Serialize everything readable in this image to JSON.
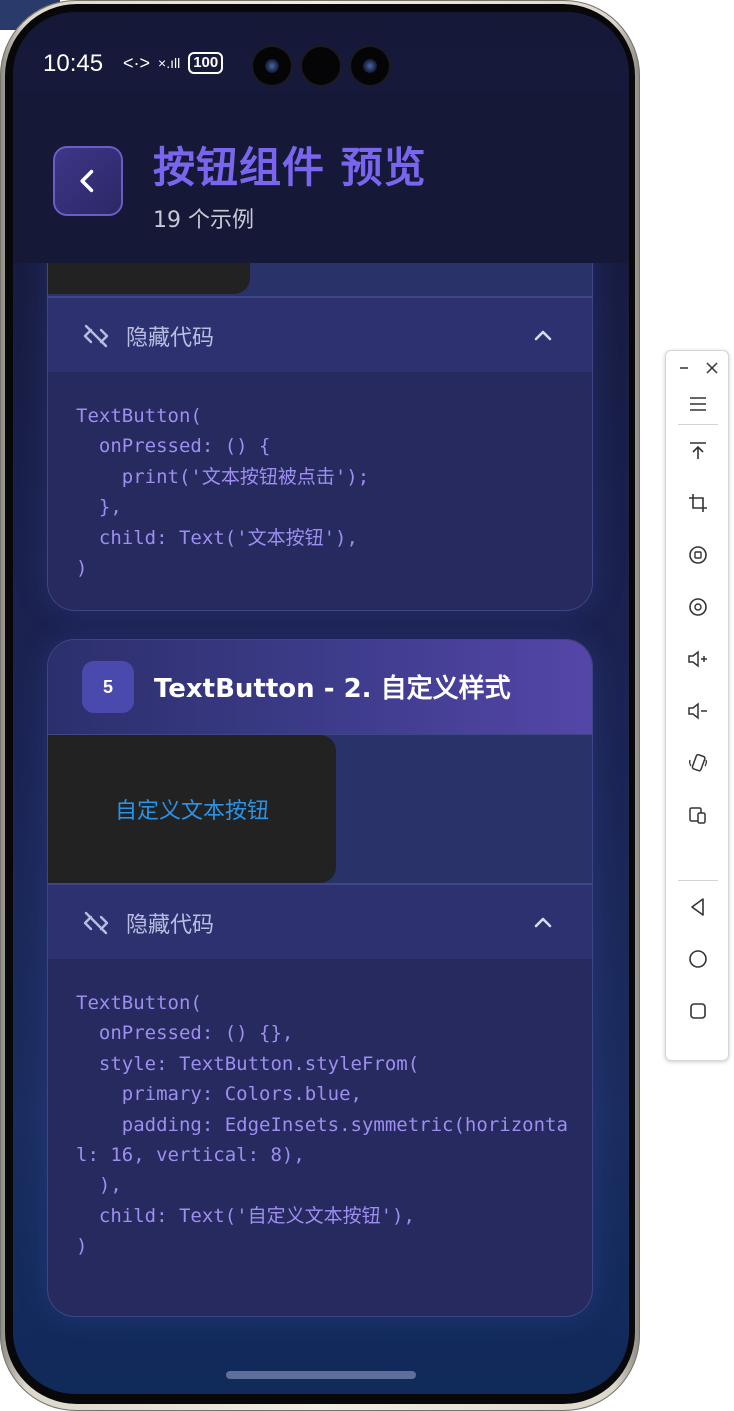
{
  "status_bar": {
    "time": "10:45",
    "data_icon": "<·>",
    "signal_label": "×.ıll",
    "battery": "100"
  },
  "header": {
    "title": "按钮组件 预览",
    "subtitle": "19 个示例"
  },
  "cards": [
    {
      "toggle_label": "隐藏代码",
      "code": "TextButton(\n  onPressed: () {\n    print('文本按钮被点击');\n  },\n  child: Text('文本按钮'),\n)"
    },
    {
      "index": "5",
      "title": "TextButton - 2. 自定义样式",
      "button_label": "自定义文本按钮",
      "toggle_label": "隐藏代码",
      "code": "TextButton(\n  onPressed: () {},\n  style: TextButton.styleFrom(\n    primary: Colors.blue,\n    padding: EdgeInsets.symmetric(horizontal: 16, vertical: 8),\n  ),\n  child: Text('自定义文本按钮'),\n)"
    }
  ],
  "toolbar": {
    "items": [
      "minimize-icon",
      "close-icon",
      "menu-icon",
      "pin-top-icon",
      "crop-icon",
      "rotate-left-icon",
      "rotate-right-icon",
      "volume-up-icon",
      "volume-down-icon",
      "shake-icon",
      "multi-screen-icon",
      "back-nav-icon",
      "home-nav-icon",
      "recent-apps-icon"
    ]
  },
  "colors": {
    "accent": "#7a66ee",
    "text_button": "#2a93e8",
    "code": "#9d8ef0",
    "card_bg": "#262a5e"
  }
}
